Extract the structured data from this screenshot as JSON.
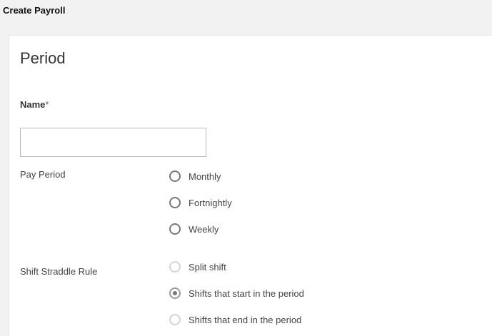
{
  "header": {
    "title": "Create Payroll"
  },
  "form": {
    "section_title": "Period",
    "name_label": "Name",
    "name_required_mark": "*",
    "name_value": "",
    "pay_period": {
      "label": "Pay Period",
      "options": [
        {
          "label": "Monthly",
          "selected": false
        },
        {
          "label": "Fortnightly",
          "selected": false
        },
        {
          "label": "Weekly",
          "selected": false
        }
      ]
    },
    "shift_straddle_rule": {
      "label": "Shift Straddle Rule",
      "options": [
        {
          "label": "Split shift",
          "selected": false
        },
        {
          "label": "Shifts that start in the period",
          "selected": true
        },
        {
          "label": "Shifts that end in the period",
          "selected": false
        }
      ]
    }
  }
}
